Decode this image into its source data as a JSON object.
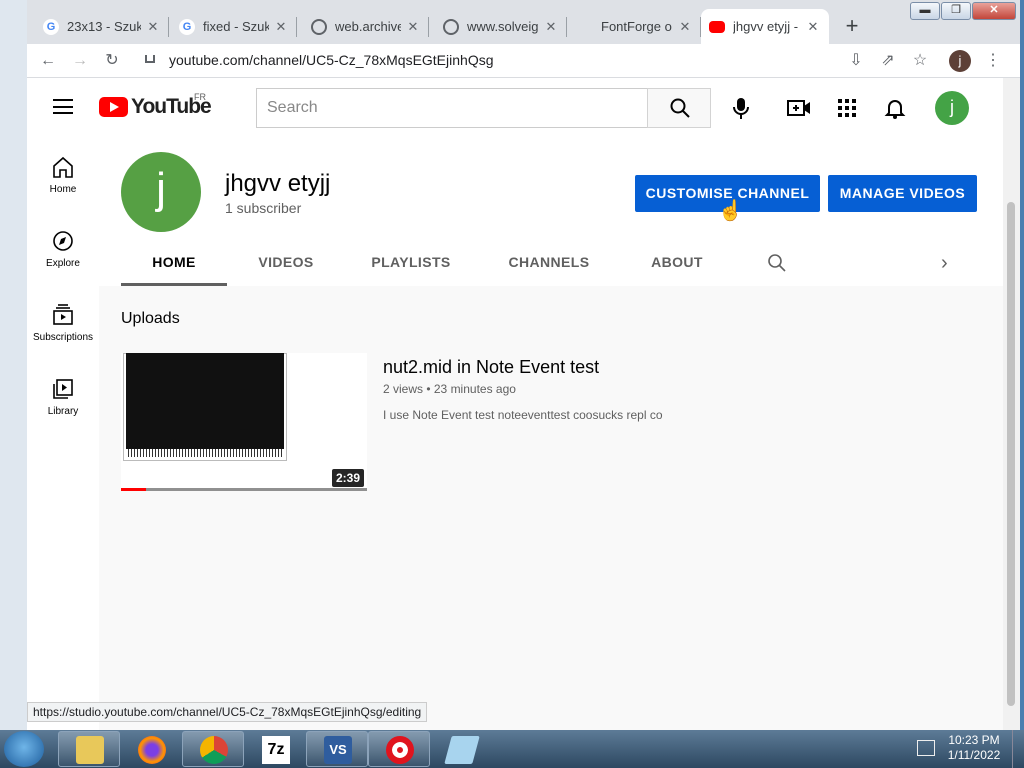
{
  "browser": {
    "tabs": [
      {
        "title": "23x13 - Szuk",
        "favicon": "google-g"
      },
      {
        "title": "fixed - Szuka",
        "favicon": "google-g"
      },
      {
        "title": "web.archive.",
        "favicon": "globe"
      },
      {
        "title": "www.solveig",
        "favicon": "globe"
      },
      {
        "title": "FontForge o",
        "favicon": "none"
      },
      {
        "title": "jhgvv etyjj -",
        "favicon": "youtube"
      }
    ],
    "new_tab": "+",
    "url": "youtube.com/channel/UC5-Cz_78xMqsEGtEjinhQsg",
    "profile_initial": "j",
    "status_url": "https://studio.youtube.com/channel/UC5-Cz_78xMqsEGtEjinhQsg/editing"
  },
  "youtube": {
    "logo_text": "YouTube",
    "country_code": "FR",
    "search_placeholder": "Search",
    "avatar_initial": "j",
    "guide": [
      {
        "label": "Home",
        "icon": "home-icon"
      },
      {
        "label": "Explore",
        "icon": "compass-icon"
      },
      {
        "label": "Subscriptions",
        "icon": "subscriptions-icon"
      },
      {
        "label": "Library",
        "icon": "library-icon"
      }
    ],
    "channel": {
      "avatar_initial": "j",
      "name": "jhgvv etyjj",
      "subscribers": "1 subscriber",
      "customise_label": "CUSTOMISE CHANNEL",
      "manage_label": "MANAGE VIDEOS"
    },
    "channel_tabs": [
      "HOME",
      "VIDEOS",
      "PLAYLISTS",
      "CHANNELS",
      "ABOUT"
    ],
    "uploads_heading": "Uploads",
    "video": {
      "title": "nut2.mid in Note Event test",
      "meta": "2 views • 23 minutes ago",
      "description": "I use Note Event test noteeventtest coosucks repl co",
      "duration": "2:39",
      "watched_fraction": 0.1
    }
  },
  "taskbar": {
    "time": "10:23 PM",
    "date": "1/11/2022",
    "apps": [
      "explorer",
      "firefox",
      "chrome",
      "7z",
      "vs",
      "record",
      "paint"
    ],
    "sevenzip_label": "7z",
    "vs_label": "VS"
  },
  "colors": {
    "brand_red": "#ff0000",
    "button_blue": "#065fd4",
    "avatar_green": "#44a346"
  }
}
